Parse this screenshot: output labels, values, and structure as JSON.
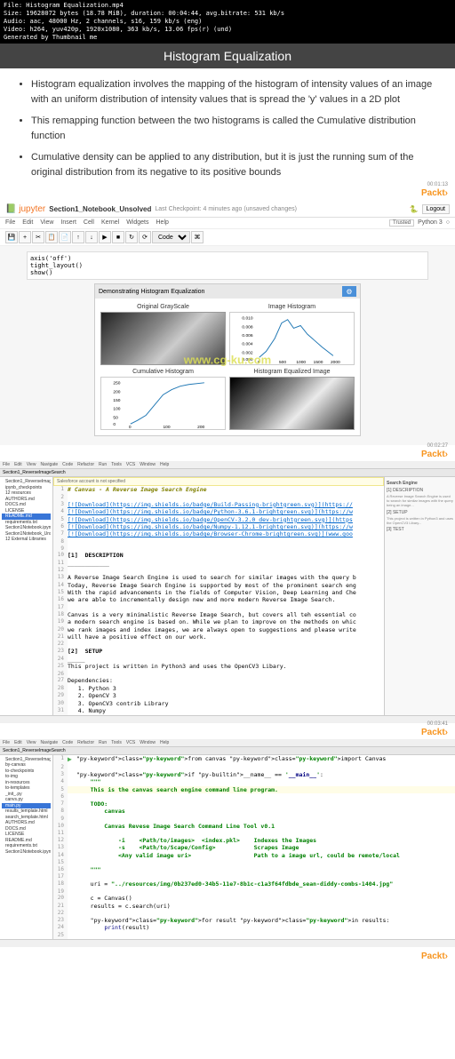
{
  "file_info": {
    "line1": "File: Histogram Equalization.mp4",
    "line2": "Size: 19628072 bytes (18.78 MiB), duration: 00:04:44, avg.bitrate: 531 kb/s",
    "line3": "Audio: aac, 48000 Hz, 2 channels, s16, 159 kb/s (eng)",
    "line4": "Video: h264, yuv420p, 1920x1080, 363 kb/s, 13.06 fps(r) (und)",
    "line5": "Generated by Thumbnail me"
  },
  "slide": {
    "title": "Histogram Equalization",
    "bullets": [
      "Histogram equalization involves the mapping of the histogram of intensity values of an image with an uniform distribution of intensity values that is spread the 'y' values in a 2D plot",
      "This remapping function between the two histograms is called the Cumulative distribution function",
      "Cumulative density can be applied to any distribution, but it is just the running sum of the original distribution from its negative to its positive bounds"
    ],
    "timestamp": "00:01:13",
    "brand": "Packt"
  },
  "jupyter": {
    "logo_text": "jupyter",
    "notebook": "Section1_Notebook_Unsolved",
    "checkpoint": "Last Checkpoint: 4 minutes ago (unsaved changes)",
    "logout": "Logout",
    "menus": [
      "File",
      "Edit",
      "View",
      "Insert",
      "Cell",
      "Kernel",
      "Widgets",
      "Help"
    ],
    "trusted": "Trusted",
    "kernel": "Python 3",
    "cell_type": "Code",
    "code_lines": [
      "axis('off')",
      "tight_layout()",
      "show()"
    ],
    "demo_title": "Demonstrating Histogram Equalization",
    "chart_titles": [
      "Original GrayScale",
      "Image Histogram",
      "Cumulative Histogram",
      "Histogram Equalized Image"
    ],
    "timestamp": "00:02:27",
    "brand": "Packt",
    "watermark": "www.cg-ku.com"
  },
  "chart_data": [
    {
      "type": "line",
      "title": "Image Histogram",
      "xlabel": "",
      "ylabel": "",
      "x": [
        0,
        250,
        500,
        750,
        1000,
        1250,
        1500,
        1750,
        2000
      ],
      "values": [
        0.001,
        0.003,
        0.005,
        0.009,
        0.01,
        0.008,
        0.006,
        0.004,
        0.001
      ],
      "xlim": [
        0,
        2000
      ],
      "ylim": [
        0,
        0.01
      ],
      "xticks": [
        0,
        500,
        1000,
        1500,
        2000
      ],
      "yticks": [
        0.0,
        0.002,
        0.004,
        0.006,
        0.008,
        0.01
      ]
    },
    {
      "type": "line",
      "title": "Cumulative Histogram",
      "xlabel": "",
      "ylabel": "",
      "x": [
        0,
        25,
        50,
        75,
        100,
        125,
        150,
        175,
        200
      ],
      "values": [
        0,
        20,
        50,
        110,
        170,
        210,
        230,
        245,
        250
      ],
      "xlim": [
        0,
        200
      ],
      "ylim": [
        0,
        250
      ],
      "xticks": [
        0,
        100,
        200
      ],
      "yticks": [
        0,
        50,
        100,
        150,
        200,
        250
      ]
    }
  ],
  "ide1": {
    "menus": [
      "File",
      "Edit",
      "View",
      "Navigate",
      "Code",
      "Refactor",
      "Run",
      "Tools",
      "VCS",
      "Window",
      "Help"
    ],
    "tab": "Section1_ReverseImageSearch",
    "sidebar_items": [
      "Section1_ReverseImageSearch",
      "ipynb_checkpoints",
      "12 resources",
      "AUTHORS.md",
      "DOCS.md",
      "LICENSE",
      "README.md",
      "requirements.txt",
      "Section1Notebook.ipynb",
      "Section1Notebook_Unsolved",
      "12 External Libraries"
    ],
    "warning": "Salesforce account is not specified",
    "editor_lines": [
      {
        "n": 1,
        "text": "# Canvas - A Reverse Image Search Engine",
        "cls": "md-header"
      },
      {
        "n": 2,
        "text": "",
        "cls": ""
      },
      {
        "n": 3,
        "text": "[![Download](https://img.shields.io/badge/Build-Passing-brightgreen.svg)](https://",
        "cls": "md-link"
      },
      {
        "n": 4,
        "text": "[![Download](https://img.shields.io/badge/Python-3.6.1-brightgreen.svg)](https://w",
        "cls": "md-link"
      },
      {
        "n": 5,
        "text": "[![Download](https://img.shields.io/badge/OpenCV-3.2.0_dev-brightgreen.svg)](https",
        "cls": "md-link"
      },
      {
        "n": 6,
        "text": "[![Download](https://img.shields.io/badge/Numpy-1.12.1-brightgreen.svg)](https://w",
        "cls": "md-link"
      },
      {
        "n": 7,
        "text": "[![Download](https://img.shields.io/badge/Browser-Chrome-brightgreen.svg)](www.goo",
        "cls": "md-link"
      },
      {
        "n": 8,
        "text": "",
        "cls": ""
      },
      {
        "n": 9,
        "text": "",
        "cls": ""
      },
      {
        "n": 10,
        "text": "[1]  DESCRIPTION",
        "cls": "md-bold"
      },
      {
        "n": 11,
        "text": "____________",
        "cls": ""
      },
      {
        "n": 12,
        "text": "",
        "cls": ""
      },
      {
        "n": 13,
        "text": "A Reverse Image Search Engine is used to search for similar images with the query b",
        "cls": ""
      },
      {
        "n": 14,
        "text": "Today, Reverse Image Search Engine is supported by most of the prominent search eng",
        "cls": ""
      },
      {
        "n": 15,
        "text": "With the rapid advancements in the fields of Computer Vision, Deep Learning and Che",
        "cls": ""
      },
      {
        "n": 16,
        "text": "we are able to incrementally design new and more modern Reverse Image Search.",
        "cls": ""
      },
      {
        "n": 17,
        "text": "",
        "cls": ""
      },
      {
        "n": 18,
        "text": "Canvas is a very minimalistic Reverse Image Search, but covers all teh essential co",
        "cls": ""
      },
      {
        "n": 19,
        "text": "a modern search engine is based on. While we plan to improve on the methods on whic",
        "cls": ""
      },
      {
        "n": 20,
        "text": "we rank images and index images, we are always open to suggestions and please write",
        "cls": ""
      },
      {
        "n": 21,
        "text": "will have a positive effect on our work.",
        "cls": ""
      },
      {
        "n": 22,
        "text": "",
        "cls": ""
      },
      {
        "n": 23,
        "text": "[2]  SETUP",
        "cls": "md-bold"
      },
      {
        "n": 24,
        "text": "_____",
        "cls": ""
      },
      {
        "n": 25,
        "text": "This project is written in Python3 and uses the OpenCV3 Libary.",
        "cls": ""
      },
      {
        "n": 26,
        "text": "",
        "cls": ""
      },
      {
        "n": 27,
        "text": "Dependencies:",
        "cls": ""
      },
      {
        "n": 28,
        "text": "   1. Python 3",
        "cls": ""
      },
      {
        "n": 29,
        "text": "   2. OpenCV 3",
        "cls": ""
      },
      {
        "n": 30,
        "text": "   3. OpenCV3 contrib Library",
        "cls": ""
      },
      {
        "n": 31,
        "text": "   4. Numpy",
        "cls": ""
      }
    ],
    "right_panel": {
      "title": "Search Engine",
      "sections": [
        "[1] DESCRIPTION",
        "[2] SETUP",
        "[3] TEST"
      ]
    },
    "timestamp": "00:03:41",
    "brand": "Packt"
  },
  "ide2": {
    "tab": "Section1_ReverseImageSearch",
    "sidebar_items": [
      "Section1_ReverseImageSearch",
      "by-canvas",
      "to-checkpoints",
      "to-img",
      "in-resources",
      "to-templates",
      "_init_.py",
      "canvs.py",
      "main.py",
      "results_template.html",
      "search_template.html",
      "AUTHORS.md",
      "DOCS.md",
      "LICENSE",
      "README.md",
      "requirements.txt",
      "Section1Notebook.ipynb"
    ],
    "editor_lines": [
      {
        "n": 1,
        "pre": "▶",
        "text": "from canvas import Canvas",
        "cls": ""
      },
      {
        "n": 2,
        "text": "",
        "cls": ""
      },
      {
        "n": 3,
        "text": "if __name__ == '__main__':",
        "cls": ""
      },
      {
        "n": 4,
        "text": "    \"\"\"",
        "cls": "py-string"
      },
      {
        "n": 5,
        "text": "    This is the canvas search engine command line program.",
        "cls": "py-string"
      },
      {
        "n": 6,
        "text": "",
        "cls": "py-string"
      },
      {
        "n": 7,
        "text": "    TODO:",
        "cls": "py-string"
      },
      {
        "n": 8,
        "text": "        canvas",
        "cls": "py-string"
      },
      {
        "n": 9,
        "text": "",
        "cls": "py-string"
      },
      {
        "n": 10,
        "text": "        Canvas Revese Image Search Command Line Tool v0.1",
        "cls": "py-string"
      },
      {
        "n": 11,
        "text": "",
        "cls": "py-string"
      },
      {
        "n": 12,
        "text": "            -i    <Path/to/images>  <index.pkl>    Indexes the Images",
        "cls": "py-string"
      },
      {
        "n": 13,
        "text": "            -s    <Path/to/Scape/Config>           Scrapes Image",
        "cls": "py-string"
      },
      {
        "n": 14,
        "text": "            <Any valid image uri>                  Path to a image url, could be remote/local",
        "cls": "py-string"
      },
      {
        "n": 15,
        "text": "",
        "cls": "py-string"
      },
      {
        "n": 16,
        "text": "    \"\"\"",
        "cls": "py-string"
      },
      {
        "n": 17,
        "text": "",
        "cls": ""
      },
      {
        "n": 18,
        "text": "    uri = \"../resources/img/0b237ed0-34b5-11e7-8b1c-c1a3f64fdbde_sean-diddy-combs-1404.jpg\"",
        "cls": ""
      },
      {
        "n": 19,
        "text": "",
        "cls": ""
      },
      {
        "n": 20,
        "text": "    c = Canvas()",
        "cls": ""
      },
      {
        "n": 21,
        "text": "    results = c.search(uri)",
        "cls": ""
      },
      {
        "n": 22,
        "text": "",
        "cls": ""
      },
      {
        "n": 23,
        "text": "    for result in results:",
        "cls": ""
      },
      {
        "n": 24,
        "text": "        print(result)",
        "cls": ""
      },
      {
        "n": 25,
        "text": "",
        "cls": ""
      }
    ],
    "timestamp": "",
    "brand": "Packt"
  }
}
